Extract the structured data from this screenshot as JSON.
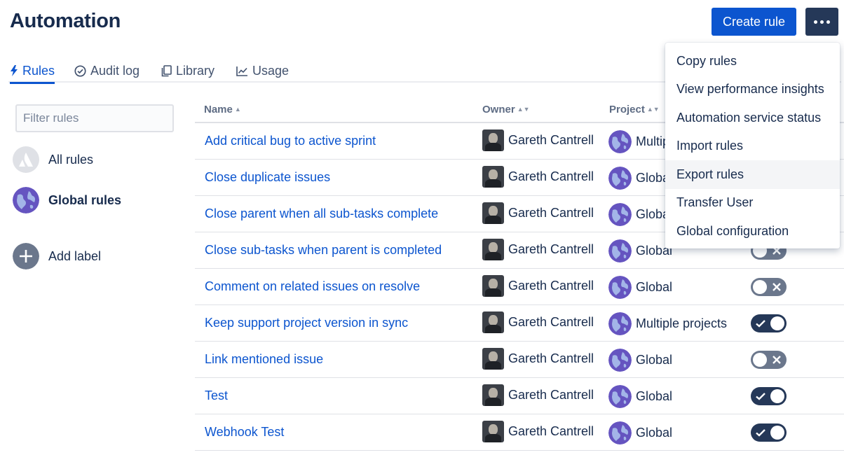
{
  "header": {
    "title": "Automation",
    "create_label": "Create rule"
  },
  "tabs": [
    {
      "label": "Rules",
      "icon": "bolt-icon",
      "active": true
    },
    {
      "label": "Audit log",
      "icon": "check-circle-icon",
      "active": false
    },
    {
      "label": "Library",
      "icon": "copy-icon",
      "active": false
    },
    {
      "label": "Usage",
      "icon": "chart-icon",
      "active": false
    }
  ],
  "sidebar": {
    "filter_placeholder": "Filter rules",
    "items": [
      {
        "label": "All rules",
        "icon": "atlassian-logo-icon"
      },
      {
        "label": "Global rules",
        "icon": "globe-icon"
      },
      {
        "label": "Add label",
        "icon": "plus-circle-icon"
      }
    ]
  },
  "table": {
    "headers": {
      "name": "Name",
      "owner": "Owner",
      "project": "Project"
    },
    "rows": [
      {
        "name": "Add critical bug to active sprint",
        "owner": "Gareth Cantrell",
        "project": "Multiple projects",
        "enabled": true
      },
      {
        "name": "Close duplicate issues",
        "owner": "Gareth Cantrell",
        "project": "Global",
        "enabled": true
      },
      {
        "name": "Close parent when all sub-tasks complete",
        "owner": "Gareth Cantrell",
        "project": "Global",
        "enabled": true
      },
      {
        "name": "Close sub-tasks when parent is completed",
        "owner": "Gareth Cantrell",
        "project": "Global",
        "enabled": false
      },
      {
        "name": "Comment on related issues on resolve",
        "owner": "Gareth Cantrell",
        "project": "Global",
        "enabled": false
      },
      {
        "name": "Keep support project version in sync",
        "owner": "Gareth Cantrell",
        "project": "Multiple projects",
        "enabled": true
      },
      {
        "name": "Link mentioned issue",
        "owner": "Gareth Cantrell",
        "project": "Global",
        "enabled": false
      },
      {
        "name": "Test",
        "owner": "Gareth Cantrell",
        "project": "Global",
        "enabled": true
      },
      {
        "name": "Webhook Test",
        "owner": "Gareth Cantrell",
        "project": "Global",
        "enabled": true
      }
    ]
  },
  "more_menu": {
    "items": [
      {
        "label": "Copy rules"
      },
      {
        "label": "View performance insights"
      },
      {
        "label": "Automation service status"
      },
      {
        "label": "Import rules"
      },
      {
        "label": "Export rules",
        "hover": true
      },
      {
        "label": "Transfer User"
      },
      {
        "label": "Global configuration"
      }
    ]
  },
  "colors": {
    "primary": "#0c55cf",
    "dark": "#253858",
    "toggle_off": "#6b778c",
    "text": "#172b4d"
  }
}
